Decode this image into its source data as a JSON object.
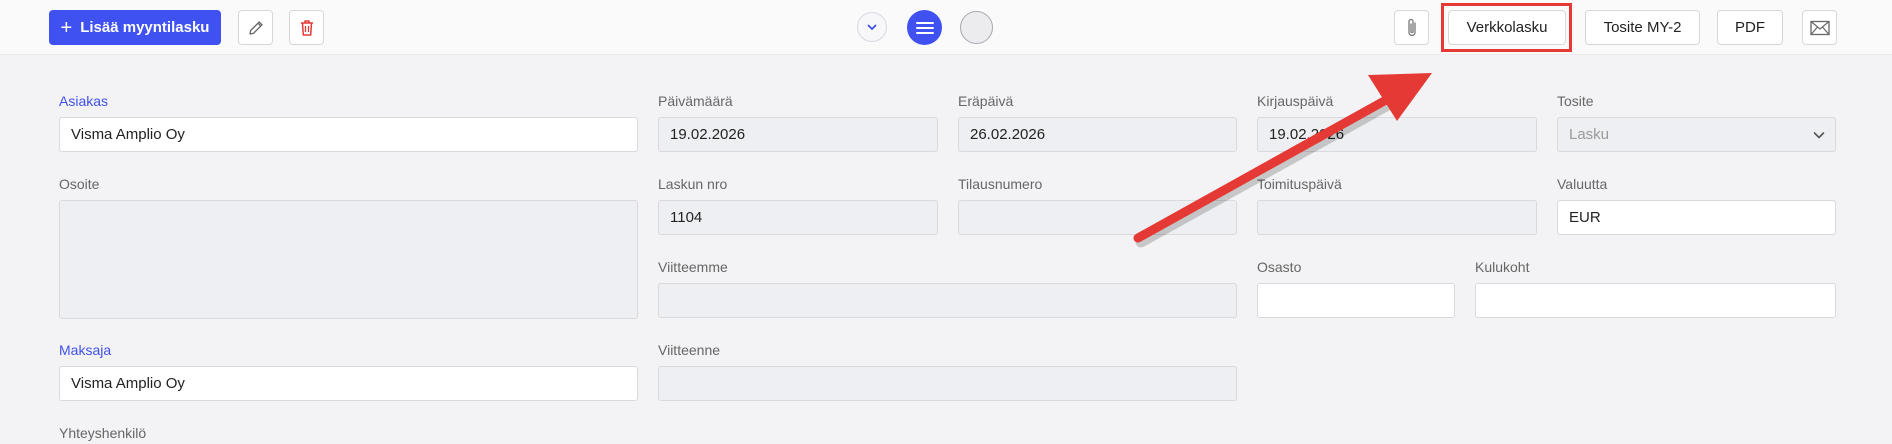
{
  "toolbar": {
    "add_label": "Lisää myyntilasku",
    "einvoice_label": "Verkkolasku",
    "voucher_label": "Tosite MY-2",
    "pdf_label": "PDF"
  },
  "form": {
    "customer": {
      "label": "Asiakas",
      "value": "Visma Amplio Oy"
    },
    "date": {
      "label": "Päivämäärä",
      "value": "19.02.2026"
    },
    "due_date": {
      "label": "Eräpäivä",
      "value": "26.02.2026"
    },
    "booking_date": {
      "label": "Kirjauspäivä",
      "value": "19.02.2026"
    },
    "voucher_type": {
      "label": "Tosite",
      "value": "Lasku"
    },
    "address": {
      "label": "Osoite",
      "value": ""
    },
    "invoice_no": {
      "label": "Laskun nro",
      "value": "1104"
    },
    "order_no": {
      "label": "Tilausnumero",
      "value": ""
    },
    "delivery_date": {
      "label": "Toimituspäivä",
      "value": ""
    },
    "currency": {
      "label": "Valuutta",
      "value": "EUR"
    },
    "our_reference": {
      "label": "Viitteemme",
      "value": ""
    },
    "department": {
      "label": "Osasto",
      "value": ""
    },
    "cost_center": {
      "label": "Kulukoht",
      "value": ""
    },
    "payer": {
      "label": "Maksaja",
      "value": "Visma Amplio Oy"
    },
    "your_reference": {
      "label": "Viitteenne",
      "value": ""
    },
    "contact_person": {
      "label": "Yhteyshenkilö"
    }
  },
  "colors": {
    "primary": "#3f51f0",
    "annotation": "#e53935",
    "delete": "#e53935"
  },
  "icons": [
    "plus-icon",
    "pencil-icon",
    "trash-icon",
    "chevron-down-icon",
    "menu-icon",
    "paperclip-icon",
    "envelope-icon"
  ]
}
